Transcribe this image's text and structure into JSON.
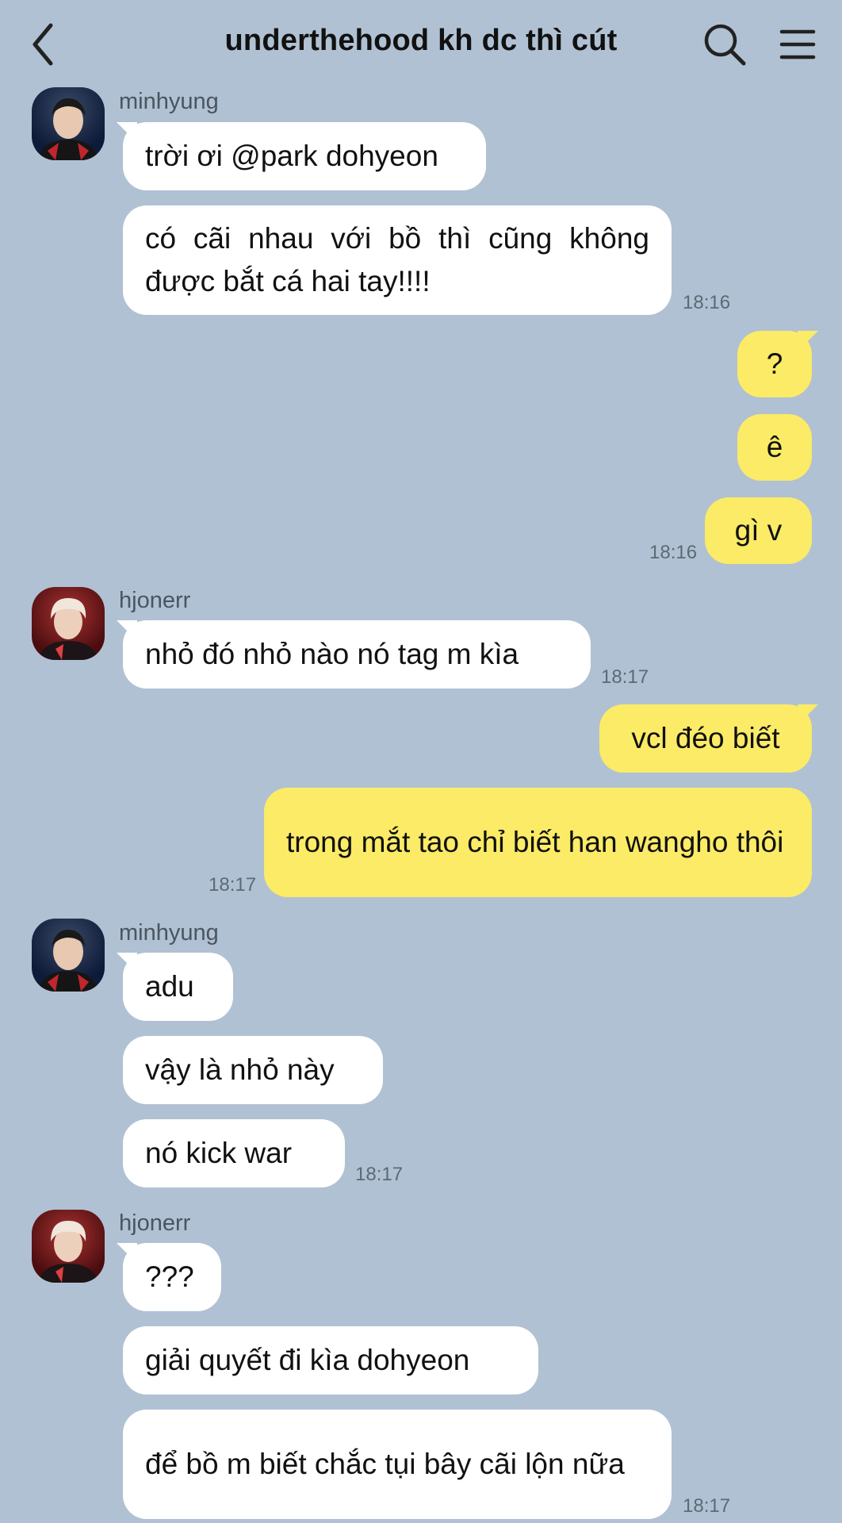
{
  "header": {
    "title": "underthehood kh dc thì cút"
  },
  "colors": {
    "background": "#b0c1d3",
    "my_bubble": "#fbeb66",
    "their_bubble": "#ffffff"
  },
  "messages": [
    {
      "sender": "minhyung"
    },
    {
      "text": "trời ơi @park dohyeon"
    },
    {
      "text": "có cãi nhau với bồ thì cũng không được bắt cá hai tay!!!!",
      "time": "18:16"
    },
    {
      "text": "?"
    },
    {
      "text": "ê"
    },
    {
      "text": "gì v",
      "time": "18:16"
    },
    {
      "sender": "hjonerr"
    },
    {
      "text": "nhỏ đó nhỏ nào nó tag m kìa",
      "time": "18:17"
    },
    {
      "text": "vcl đéo biết"
    },
    {
      "text": "trong mắt tao chỉ biết han wangho thôi",
      "time": "18:17"
    },
    {
      "sender": "minhyung"
    },
    {
      "text": "adu"
    },
    {
      "text": "vậy là nhỏ này"
    },
    {
      "text": "nó kick war",
      "time": "18:17"
    },
    {
      "sender": "hjonerr"
    },
    {
      "text": "???"
    },
    {
      "text": "giải quyết đi kìa dohyeon"
    },
    {
      "text": "để bồ m biết chắc tụi bây cãi lộn nữa",
      "time": "18:17"
    }
  ]
}
